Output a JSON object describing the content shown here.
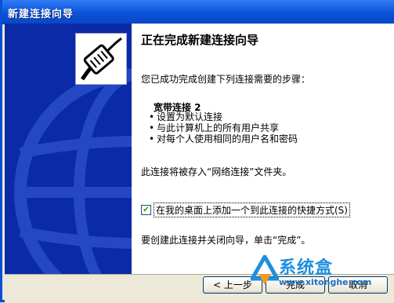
{
  "window": {
    "title": "新建连接向导"
  },
  "wizard": {
    "heading": "正在完成新建连接向导",
    "intro": "您已成功完成创建下列连接需要的步骤：",
    "connection_name": "宽带连接 2",
    "bullets": [
      "设置为默认连接",
      "与此计算机上的所有用户共享",
      "对每个人使用相同的用户名和密码"
    ],
    "saved_text": "此连接将被存入“网络连接”文件夹。",
    "shortcut_checkbox": {
      "label": "在我的桌面上添加一个到此连接的快捷方式(S)",
      "checked": true
    },
    "finish_text": "要创建此连接并关闭向导，单击“完成”。"
  },
  "buttons": {
    "back": "< 上一步",
    "finish": "完成",
    "cancel": "取消"
  },
  "watermark": {
    "text": "系统盒",
    "url": "www.xitonghe.com"
  },
  "colors": {
    "title_bar": "#0b52d8",
    "left_pane": "#0b2aa6",
    "window_bg": "#ece9d8"
  },
  "icons": {
    "wizard": "network-cable-icon",
    "watermark": "xitonghe-logo-icon"
  }
}
